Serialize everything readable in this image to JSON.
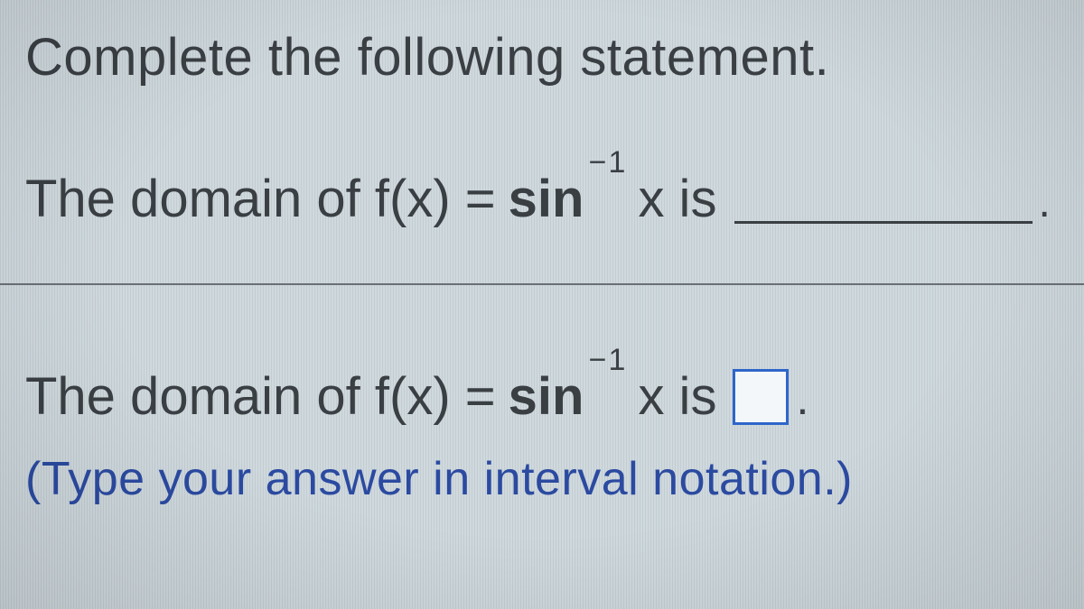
{
  "question": {
    "instruction": "Complete the following statement.",
    "statement_lead": "The domain of f(x) =",
    "function_base": "sin",
    "function_exponent_minus": "−",
    "function_exponent_one": "1",
    "statement_after": "x is",
    "period": "."
  },
  "answer": {
    "statement_lead": "The domain of f(x) =",
    "function_base": "sin",
    "function_exponent_minus": "−",
    "function_exponent_one": "1",
    "statement_after": "x is",
    "period": ".",
    "hint": "(Type your answer in interval notation.)"
  }
}
